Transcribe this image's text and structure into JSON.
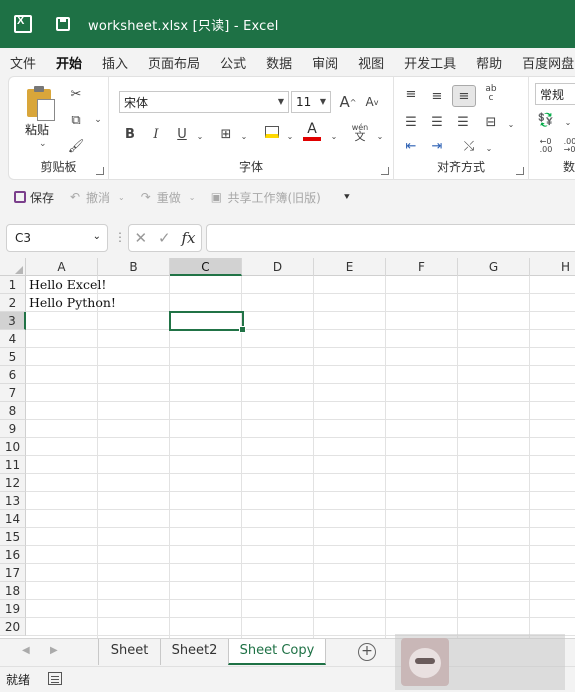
{
  "titlebar": {
    "title": "worksheet.xlsx  [只读]  -  Excel"
  },
  "menu": [
    "文件",
    "开始",
    "插入",
    "页面布局",
    "公式",
    "数据",
    "审阅",
    "视图",
    "开发工具",
    "帮助",
    "百度网盘"
  ],
  "menu_active": "开始",
  "ribbon": {
    "clipboard": {
      "paste": "粘贴",
      "label": "剪贴板"
    },
    "font": {
      "font_name": "宋体",
      "font_size": "11",
      "grow": "A",
      "shrink": "A",
      "bold": "B",
      "italic": "I",
      "underline": "U",
      "phonetic_top": "wén",
      "phonetic_bottom": "文",
      "font_color_letter": "A",
      "label": "字体"
    },
    "alignment": {
      "wrap_top": "ab",
      "wrap_bottom": "c",
      "label": "对齐方式"
    },
    "number": {
      "format": "常规",
      "label": "数字"
    }
  },
  "quickbar": {
    "save": "保存",
    "undo": "撤消",
    "redo": "重做",
    "share": "共享工作簿(旧版)"
  },
  "formula": {
    "namebox": "C3",
    "fx": "fx",
    "cancel": "✕",
    "enter": "✓",
    "value": ""
  },
  "columns": [
    "A",
    "B",
    "C",
    "D",
    "E",
    "F",
    "G",
    "H"
  ],
  "selected_column": "C",
  "rows": [
    "1",
    "2",
    "3",
    "4",
    "5",
    "6",
    "7",
    "8",
    "9",
    "10",
    "11",
    "12",
    "13",
    "14",
    "15",
    "16",
    "17",
    "18",
    "19",
    "20"
  ],
  "selected_row": "3",
  "cells": {
    "A1": "Hello Excel!",
    "A2": "Hello Python!"
  },
  "sheets": [
    "Sheet",
    "Sheet2",
    "Sheet Copy"
  ],
  "active_sheet": "Sheet Copy",
  "status": "就绪",
  "colors": {
    "accent": "#1e7145",
    "selection": "#217346"
  }
}
